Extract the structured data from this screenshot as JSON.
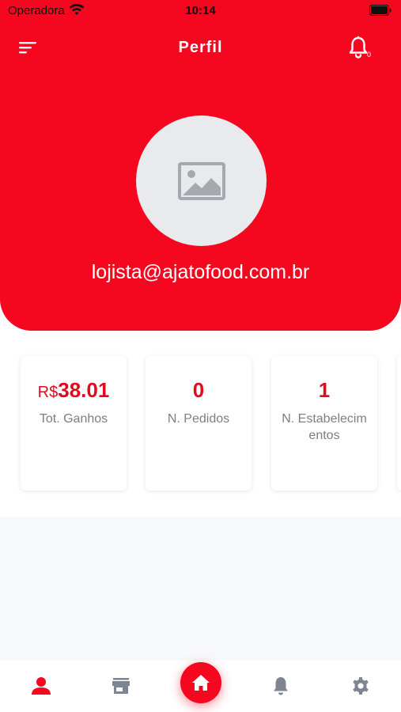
{
  "status_bar": {
    "carrier": "Operadora",
    "time": "10:14"
  },
  "header": {
    "title": "Perfil",
    "notification_count": "0",
    "email": "lojista@ajatofood.com.br"
  },
  "stats": [
    {
      "currency": "R$",
      "value": "38.01",
      "label": "Tot. Ganhos"
    },
    {
      "value": "0",
      "label": "N. Pedidos"
    },
    {
      "value": "1",
      "label": "N. Estabelecimentos"
    }
  ],
  "icons": {
    "menu": "menu-icon",
    "bell": "bell-icon",
    "avatar_placeholder": "image-placeholder-icon",
    "nav_profile": "user-icon",
    "nav_store": "store-icon",
    "nav_home": "home-icon",
    "nav_notifications": "bell-icon",
    "nav_settings": "gear-icon"
  },
  "colors": {
    "primary": "#f5071f",
    "accent_text": "#e2091e",
    "muted_text": "#7a7f87",
    "nav_inactive": "#7d8593"
  }
}
